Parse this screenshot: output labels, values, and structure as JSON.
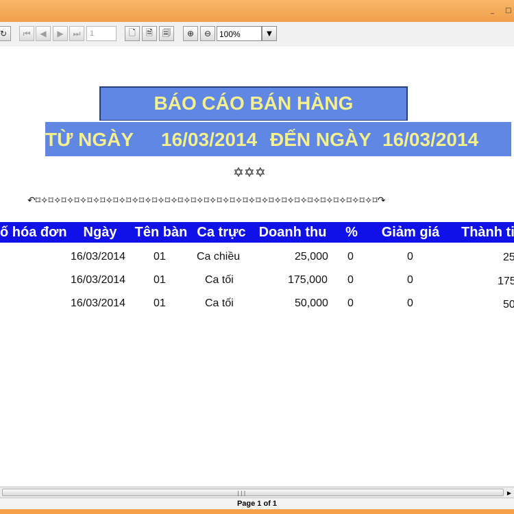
{
  "window": {
    "controls": {
      "minimize": "_",
      "maximize": "□"
    }
  },
  "toolbar": {
    "reload_glyph": "↻",
    "first_glyph": "⏮",
    "prev_glyph": "◀",
    "next_glyph": "▶",
    "last_glyph": "⏭",
    "page_value": "1",
    "page_glyph": "🗋",
    "page_width_glyph": "🗎",
    "fit_glyph": "🗐",
    "zoom_in_glyph": "⊕",
    "zoom_out_glyph": "⊖",
    "zoom_value": "100%",
    "zoom_dropdown_glyph": "▼"
  },
  "report": {
    "title": "BÁO CÁO BÁN HÀNG",
    "from_label": "TỪ NGÀY",
    "from_date": "16/03/2014",
    "to_label": "ĐẾN NGÀY",
    "to_date": "16/03/2014",
    "stars": "✡✡✡",
    "ornament": "↶⌑✧⌑✧⌑✧⌑✧⌑✧⌑✧⌑✧⌑✧⌑✧⌑✧⌑✧⌑✧⌑✧⌑✧⌑✧⌑✧⌑✧⌑✧⌑✧⌑✧⌑✧⌑✧⌑✧⌑✧⌑✧⌑✧⌑↷",
    "columns": [
      "ố hóa đơn",
      "Ngày",
      "Tên bàn",
      "Ca trực",
      "Doanh thu",
      "%",
      "Giảm giá",
      "Thành ti"
    ],
    "rows": [
      {
        "ngay": "16/03/2014",
        "ten_ban": "01",
        "ca_truc": "Ca chiều",
        "doanh_thu": "25,000",
        "phan_tram": "0",
        "giam_gia": "0",
        "thanh_tien": "25"
      },
      {
        "ngay": "16/03/2014",
        "ten_ban": "01",
        "ca_truc": "Ca tối",
        "doanh_thu": "175,000",
        "phan_tram": "0",
        "giam_gia": "0",
        "thanh_tien": "175"
      },
      {
        "ngay": "16/03/2014",
        "ten_ban": "01",
        "ca_truc": "Ca tối",
        "doanh_thu": "50,000",
        "phan_tram": "0",
        "giam_gia": "0",
        "thanh_tien": "50"
      }
    ]
  },
  "scrollbar": {
    "grip": "|||",
    "right_arrow": "▶"
  },
  "status": {
    "page_info": "Page 1 of 1"
  },
  "colors": {
    "window_frame": "#f4a14a",
    "title_fill": "#5f87e3",
    "title_text": "#f4ef8f",
    "header_fill": "#1010e8"
  }
}
